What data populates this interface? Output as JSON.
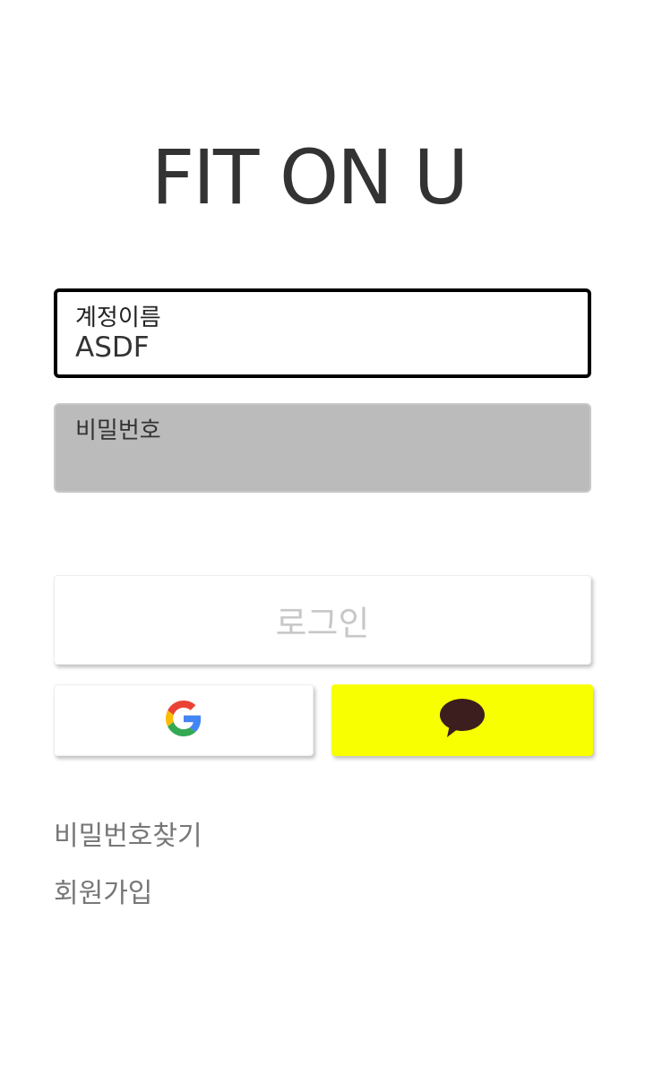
{
  "app": {
    "title": "FIT ON U"
  },
  "form": {
    "username": {
      "label": "계정이름",
      "value": "ASDF"
    },
    "password": {
      "label": "비밀번호",
      "value": ""
    },
    "login_label": "로그인"
  },
  "social": {
    "google_icon": "google-logo",
    "kakao_icon": "speech-bubble",
    "colors": {
      "kakao_bg": "#f7ff00",
      "kakao_bubble": "#3c1e1e"
    }
  },
  "links": {
    "find_password": "비밀번호찾기",
    "signup": "회원가입"
  },
  "colors": {
    "password_field_bg": "#bbbbbb",
    "login_text": "#c8c8c8",
    "link_text": "#777777"
  }
}
